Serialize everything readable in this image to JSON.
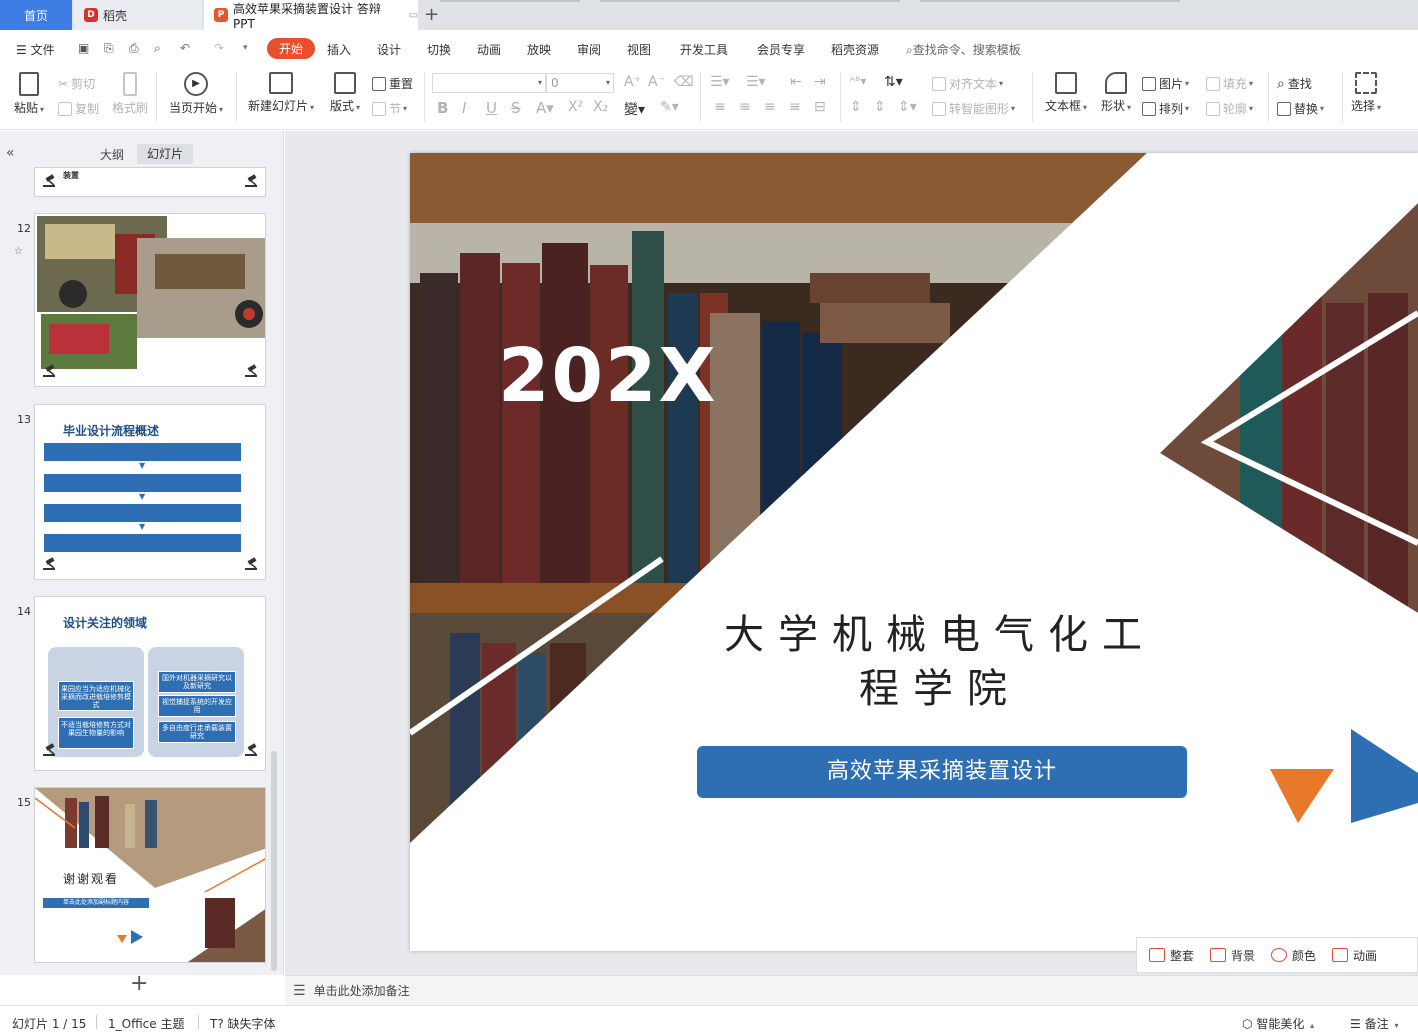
{
  "tabs": {
    "home": "首页",
    "daoke": "稻壳",
    "document": "高效苹果采摘装置设计 答辩PPT"
  },
  "menu": {
    "file": "文件",
    "start": "开始",
    "insert": "插入",
    "design": "设计",
    "transition": "切换",
    "animation": "动画",
    "slideshow": "放映",
    "review": "审阅",
    "view": "视图",
    "devtools": "开发工具",
    "member": "会员专享",
    "daoke_resources": "稻壳资源",
    "search": "查找命令、搜索模板"
  },
  "ribbon": {
    "paste": "粘贴",
    "cut": "剪切",
    "copy": "复制",
    "format_painter": "格式刷",
    "from_current": "当页开始",
    "new_slide": "新建幻灯片",
    "layout": "版式",
    "reset": "重置",
    "section": "节",
    "font_size": "0",
    "align_text": "对齐文本",
    "smart_shape": "转智能图形",
    "text_box": "文本框",
    "shape": "形状",
    "picture": "图片",
    "arrange": "排列",
    "fill": "填充",
    "outline": "轮廓",
    "find": "查找",
    "replace": "替换",
    "select": "选择"
  },
  "left_pane": {
    "outline_tab": "大纲",
    "slides_tab": "幻灯片",
    "thumbs": [
      {
        "num": "12",
        "title": ""
      },
      {
        "num": "13",
        "title": "毕业设计流程概述"
      },
      {
        "num": "14",
        "title": "设计关注的领域",
        "boxes": [
          "果园应当为适应机械化采摘而改进栽培修剪模式",
          "不适当栽培修剪方式对果园生物量的影响",
          "国外对机器采摘研究以及新研究",
          "视觉捕捉系统的开发应用",
          "多自由度行走承载装置研究"
        ]
      },
      {
        "num": "15",
        "title": "谢谢观看",
        "subtitle": "单击此处添加副标题内容"
      }
    ],
    "prev_thumb_text": "装置"
  },
  "slide": {
    "year": "202X",
    "title": "大学机械电气化工程学院",
    "button": "高效苹果采摘装置设计"
  },
  "slide_toolbar": {
    "suite": "整套",
    "background": "背景",
    "color": "颜色",
    "animation": "动画"
  },
  "notes": {
    "placeholder": "单击此处添加备注"
  },
  "status": {
    "slide_counter": "幻灯片 1 / 15",
    "theme": "1_Office 主题",
    "missing_font": "缺失字体",
    "smart_beautify": "智能美化",
    "notes": "备注"
  },
  "colors": {
    "accent_red": "#e94e2d",
    "slide_blue": "#2e6eb3",
    "triangle_orange": "#e8782a",
    "tab_blue": "#3d7de4"
  }
}
